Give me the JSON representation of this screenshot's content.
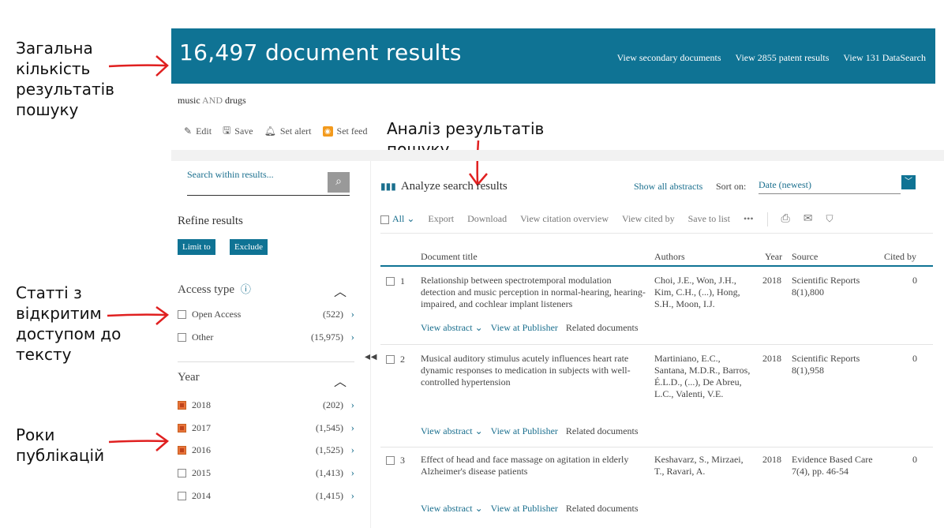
{
  "annotations": {
    "total": [
      "Загальна",
      "кількість",
      "результатів",
      "пошуку"
    ],
    "analyze": [
      "Аналіз результатів",
      "пошуку"
    ],
    "open_access": [
      "Статті з",
      "відкритим",
      "доступом до",
      "тексту"
    ],
    "years": [
      "Роки",
      "публікацій"
    ]
  },
  "header": {
    "count_title": "16,497 document results",
    "links": [
      "View secondary documents",
      "View 2855 patent results",
      "View 131 DataSearch"
    ],
    "color": "#0f7394"
  },
  "query": {
    "term1": "music",
    "operator": "AND",
    "term2": "drugs"
  },
  "toolbar": {
    "edit": "Edit",
    "save": "Save",
    "set_alert": "Set alert",
    "set_feed": "Set feed"
  },
  "sidebar": {
    "search_placeholder": "Search within results...",
    "search_icon": "search-icon",
    "refine_title": "Refine results",
    "limit_to": "Limit to",
    "exclude": "Exclude",
    "access_type": {
      "title": "Access type",
      "items": [
        {
          "label": "Open Access",
          "count": "(522)",
          "checked": false
        },
        {
          "label": "Other",
          "count": "(15,975)",
          "checked": false
        }
      ]
    },
    "year": {
      "title": "Year",
      "items": [
        {
          "label": "2018",
          "count": "(202)",
          "checked": true
        },
        {
          "label": "2017",
          "count": "(1,545)",
          "checked": true
        },
        {
          "label": "2016",
          "count": "(1,525)",
          "checked": true
        },
        {
          "label": "2015",
          "count": "(1,413)",
          "checked": false
        },
        {
          "label": "2014",
          "count": "(1,415)",
          "checked": false
        }
      ]
    }
  },
  "results": {
    "analyze": "Analyze search results",
    "show_all_abstracts": "Show all abstracts",
    "sort_on": "Sort on:",
    "sort_value": "Date (newest)",
    "actions": {
      "all": "All",
      "export": "Export",
      "download": "Download",
      "citation_overview": "View citation overview",
      "cited_by": "View cited by",
      "save_to_list": "Save to list",
      "more": "•••"
    },
    "columns": {
      "title": "Document title",
      "authors": "Authors",
      "year": "Year",
      "source": "Source",
      "cited_by": "Cited by"
    },
    "rows": [
      {
        "num": "1",
        "title": "Relationship between spectrotemporal modulation detection and music perception in normal-hearing, hearing-impaired, and cochlear implant listeners",
        "authors": "Choi, J.E., Won, J.H., Kim, C.H., (...), Hong, S.H., Moon, I.J.",
        "year": "2018",
        "source": "Scientific Reports 8(1),800",
        "cited": "0"
      },
      {
        "num": "2",
        "title": "Musical auditory stimulus acutely influences heart rate dynamic responses to medication in subjects with well-controlled hypertension",
        "authors": "Martiniano, E.C., Santana, M.D.R., Barros, É.L.D., (...), De Abreu, L.C., Valenti, V.E.",
        "year": "2018",
        "source": "Scientific Reports 8(1),958",
        "cited": "0"
      },
      {
        "num": "3",
        "title": "Effect of head and face massage on agitation in elderly Alzheimer's disease patients",
        "authors": "Keshavarz, S., Mirzaei, T., Ravari, A.",
        "year": "2018",
        "source": "Evidence Based Care 7(4), pp. 46-54",
        "cited": "0"
      }
    ],
    "row_links": {
      "abstract": "View abstract",
      "publisher": "View at Publisher",
      "related": "Related documents"
    }
  }
}
